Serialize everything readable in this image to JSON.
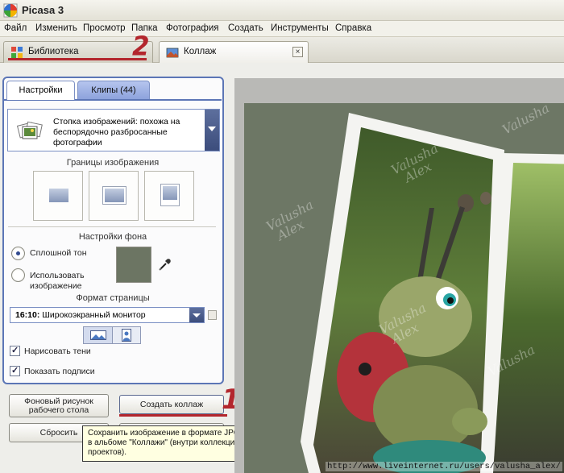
{
  "app": {
    "title": "Picasa 3"
  },
  "menu": [
    "Файл",
    "Изменить",
    "Просмотр",
    "Папка",
    "Фотография",
    "Создать",
    "Инструменты",
    "Справка"
  ],
  "tabs": {
    "library": "Библиотека",
    "collage": "Коллаж",
    "close": "×"
  },
  "annotations": {
    "mark1": "1",
    "mark2": "2"
  },
  "panel": {
    "tab_settings": "Настройки",
    "tab_clips": "Клипы (44)",
    "collage_type": "Стопка изображений: похожа на беспорядочно разбросанные фотографии",
    "borders_title": "Границы изображения",
    "background_title": "Настройки фона",
    "solid_color": "Сплошной тон",
    "use_image": "Использовать изображение",
    "page_format_title": "Формат страницы",
    "page_format_value_bold": "16:10:",
    "page_format_value": "Широкоэкранный монитор",
    "draw_shadows": "Нарисовать тени",
    "show_captions": "Показать подписи"
  },
  "buttons": {
    "wallpaper": "Фоновый рисунок рабочего стола",
    "create_collage": "Создать коллаж",
    "reset": "Сбросить"
  },
  "tooltip": "Сохранить изображение в формате JPG в альбоме \"Коллажи\" (внутри коллекции проектов).",
  "watermark": {
    "line1": "Valusha",
    "line2": "Alex"
  },
  "footer_url": "http://www.liveinternet.ru/users/valusha_alex/",
  "colors": {
    "canvas_bg": "#6d7765",
    "panel_border": "#5c76b6",
    "annotation": "#b3262d"
  }
}
